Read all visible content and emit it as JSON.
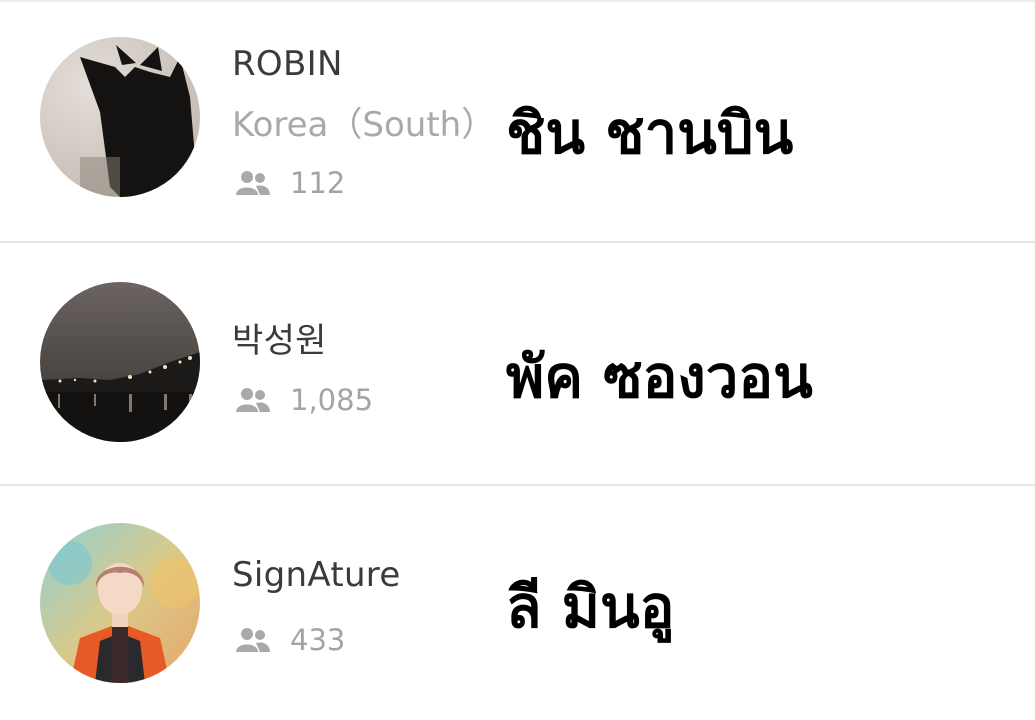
{
  "users": [
    {
      "name": "ROBIN",
      "country": "Korea（South）",
      "followers": "112",
      "thai_caption": "ชิน ชานบิน",
      "avatar_icon": "cat-silhouette-photo"
    },
    {
      "name": "박성원",
      "followers": "1,085",
      "thai_caption": "พัค ซองวอน",
      "avatar_icon": "night-city-photo"
    },
    {
      "name": "SignAture",
      "followers": "433",
      "thai_caption": "ลี มินอู",
      "avatar_icon": "person-portrait-photo"
    }
  ],
  "colors": {
    "name": "#3b3b3b",
    "secondary": "#a9a9a9",
    "caption": "#000000",
    "divider": "#e6e6e6"
  }
}
